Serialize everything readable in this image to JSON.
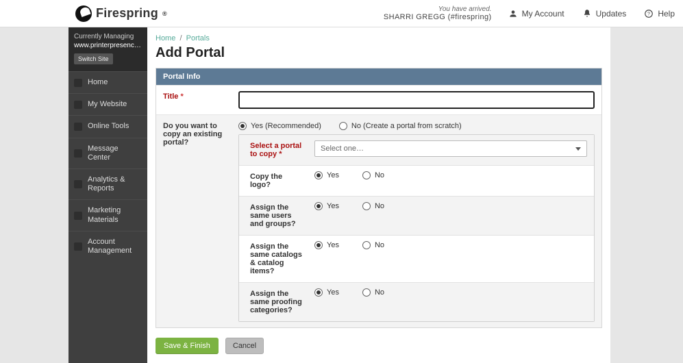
{
  "brand": {
    "name": "Firespring",
    "reg": "®"
  },
  "topbar": {
    "arrived_tag": "You have arrived.",
    "user_line": "SHARRI GREGG (#firespring)",
    "my_account": "My Account",
    "updates": "Updates",
    "help": "Help"
  },
  "sidebar": {
    "managing_label": "Currently Managing",
    "managing_url": "www.printerpresenc…",
    "switch_label": "Switch Site",
    "items": [
      {
        "label": "Home"
      },
      {
        "label": "My Website"
      },
      {
        "label": "Online Tools"
      },
      {
        "label": "Message Center"
      },
      {
        "label": "Analytics & Reports"
      },
      {
        "label": "Marketing Materials"
      },
      {
        "label": "Account Management"
      }
    ]
  },
  "crumb_home": "Home",
  "crumb_portals": "Portals",
  "page_title": "Add Portal",
  "panel_title": "Portal Info",
  "title_label": "Title",
  "asterisk": "*",
  "copy_question": "Do you want to copy an existing portal?",
  "copy_yes": "Yes (Recommended)",
  "copy_no": "No (Create a portal from scratch)",
  "select_portal_label": "Select a portal to copy",
  "select_placeholder": "Select one…",
  "q_logo": "Copy the logo?",
  "q_users": "Assign the same users and groups?",
  "q_catalog": "Assign the same catalogs & catalog items?",
  "q_proof": "Assign the same proofing categories?",
  "yes": "Yes",
  "no": "No",
  "save_label": "Save & Finish",
  "cancel_label": "Cancel"
}
